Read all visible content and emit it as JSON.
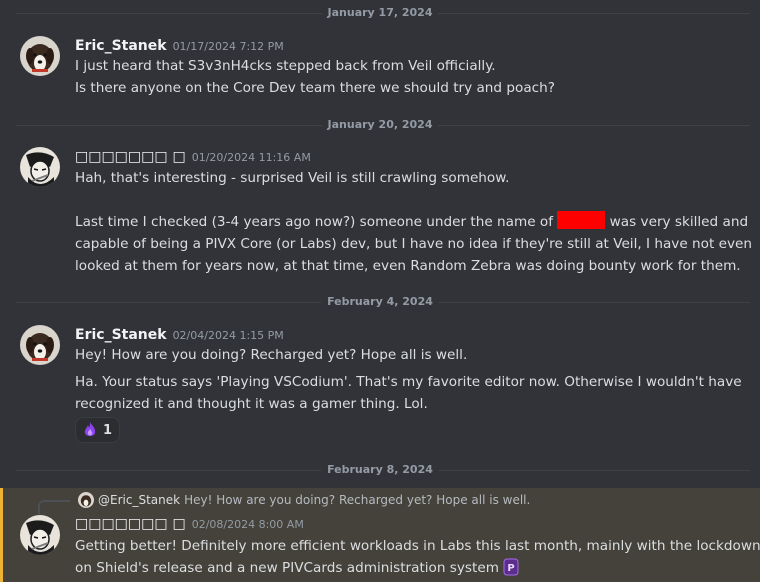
{
  "dividers": [
    "January 17, 2024",
    "January 20, 2024",
    "February 4, 2024",
    "February 8, 2024"
  ],
  "messages": [
    {
      "author": "Eric_Stanek",
      "timestamp": "01/17/2024 7:12 PM",
      "avatar": "dog-avatar-icon",
      "lines": [
        "I just heard that S3v3nH4cks stepped back from Veil officially.",
        "Is there anyone on the Core Dev team there we should try and poach?"
      ]
    },
    {
      "author": "□□□□□□□ □",
      "timestamp": "01/20/2024 11:16 AM",
      "avatar": "sketch-avatar-icon",
      "line1": "Hah, that's interesting - surprised Veil is still crawling somehow.",
      "line2_before": "Last time I checked (3-4 years ago now?) someone under the name of ",
      "line2_after": " was very skilled and",
      "line3": "capable of being a PIVX Core (or Labs) dev, but I have no idea if they're still at Veil, I have not even",
      "line4": "looked at them for years now, at that time, even Random Zebra was doing bounty work for them.",
      "redaction_color": "#ff0000"
    },
    {
      "author": "Eric_Stanek",
      "timestamp": "02/04/2024 1:15 PM",
      "avatar": "dog-avatar-icon",
      "line1": "Hey! How are you doing? Recharged yet? Hope all is well.",
      "line2": "Ha. Your status says 'Playing VSCodium'. That's my favorite editor now. Otherwise I wouldn't have",
      "line3": "recognized it and thought it was a gamer thing. Lol.",
      "reaction": {
        "icon": "purple-flame-emoji-icon",
        "count": "1"
      }
    },
    {
      "author": "□□□□□□□ □",
      "timestamp": "02/08/2024 8:00 AM",
      "avatar": "sketch-avatar-icon",
      "reply_to": {
        "author": "@Eric_Stanek",
        "text": "Hey! How are you doing? Recharged yet? Hope all is well."
      },
      "line1": "Getting better! Definitely more efficient workloads in Labs this last month, mainly with the lockdown",
      "line2": "on Shield's release and a new PIVCards administration system",
      "emoji": "pivcards-logo-icon",
      "highlight_color": "#f0b232"
    }
  ]
}
